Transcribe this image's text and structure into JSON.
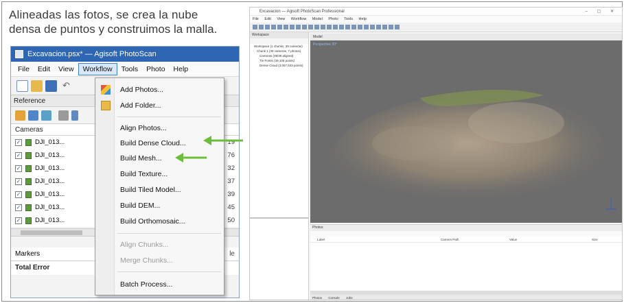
{
  "caption": {
    "line1": "Alineadas las fotos, se crea la nube",
    "line2": "densa de puntos y construimos la malla."
  },
  "window": {
    "title": "Excavacion.psx* — Agisoft PhotoScan",
    "menu": [
      "File",
      "Edit",
      "View",
      "Workflow",
      "Tools",
      "Photo",
      "Help"
    ],
    "active_menu": "Workflow"
  },
  "reference_panel": {
    "title": "Reference",
    "cameras_header": "Cameras",
    "cameras": [
      {
        "label": "DJI_013...",
        "value": "19"
      },
      {
        "label": "DJI_013...",
        "value": "76"
      },
      {
        "label": "DJI_013...",
        "value": "32"
      },
      {
        "label": "DJI_013...",
        "value": "37"
      },
      {
        "label": "DJI_013...",
        "value": "39"
      },
      {
        "label": "DJI_013...",
        "value": "45"
      },
      {
        "label": "DJI_013...",
        "value": "50"
      }
    ],
    "markers_header": "Markers",
    "markers_col": "le",
    "total_error": "Total Error"
  },
  "workflow_menu": {
    "items": [
      {
        "label": "Add Photos...",
        "icon": "add-photos-icon",
        "enabled": true
      },
      {
        "label": "Add Folder...",
        "icon": "add-folder-icon",
        "enabled": true
      },
      {
        "label": "Align Photos...",
        "enabled": true
      },
      {
        "label": "Build Dense Cloud...",
        "enabled": true,
        "highlighted": true
      },
      {
        "label": "Build Mesh...",
        "enabled": true,
        "highlighted": true
      },
      {
        "label": "Build Texture...",
        "enabled": true
      },
      {
        "label": "Build Tiled Model...",
        "enabled": true
      },
      {
        "label": "Build DEM...",
        "enabled": true
      },
      {
        "label": "Build Orthomosaic...",
        "enabled": true
      },
      {
        "label": "Align Chunks...",
        "enabled": false
      },
      {
        "label": "Merge Chunks...",
        "enabled": false
      },
      {
        "label": "Batch Process...",
        "enabled": true
      }
    ]
  },
  "colors": {
    "arrow": "#6cbd3a",
    "titlebar": "#2f66b3",
    "menu_highlight": "#d9e7f8"
  },
  "screenshot": {
    "title": "Excavacion — Agisoft PhotoScan Professional",
    "menu": [
      "File",
      "Edit",
      "View",
      "Workflow",
      "Model",
      "Photo",
      "Tools",
      "Help"
    ],
    "workspace": "Workspace",
    "tree": [
      "Workspace (1 chunks, 39 cameras)",
      "Chunk 1 (39 cameras, 7 photos)",
      "Cameras (39/39 aligned)",
      "Tie Points (39,108 points)",
      "Dense Cloud (3,057,543 points)"
    ],
    "model_tab": "Model",
    "perspective": "Perspective 30°",
    "photos_tab": "Photos",
    "columns": [
      "Label",
      "Camera Path",
      "Value",
      "Size"
    ],
    "footer_tabs": [
      "Photos",
      "Console",
      "Jobs"
    ]
  }
}
